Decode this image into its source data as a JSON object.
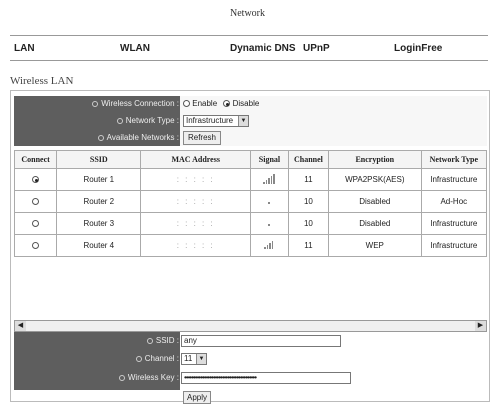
{
  "page": {
    "title": "Network"
  },
  "nav": [
    "LAN",
    "WLAN",
    "Dynamic DNS",
    "UPnP",
    "LoginFree"
  ],
  "section": {
    "title": "Wireless LAN"
  },
  "top_form": {
    "wireless_connection_label": "Wireless Connection :",
    "enable_label": "Enable",
    "disable_label": "Disable",
    "selected": "Disable",
    "network_type_label": "Network Type :",
    "network_type_value": "Infrastructure",
    "available_networks_label": "Available Networks :",
    "refresh_label": "Refresh"
  },
  "table": {
    "headers": [
      "Connect",
      "SSID",
      "MAC Address",
      "Signal",
      "Channel",
      "Encryption",
      "Network Type"
    ],
    "rows": [
      {
        "selected": true,
        "ssid": "Router 1",
        "mac": ": : : : :",
        "signal": 5,
        "channel": "11",
        "encryption": "WPA2PSK(AES)",
        "network_type": "Infrastructure"
      },
      {
        "selected": false,
        "ssid": "Router 2",
        "mac": ": : : : :",
        "signal": 0,
        "channel": "10",
        "encryption": "Disabled",
        "network_type": "Ad-Hoc"
      },
      {
        "selected": false,
        "ssid": "Router 3",
        "mac": ": : : : :",
        "signal": 1,
        "channel": "10",
        "encryption": "Disabled",
        "network_type": "Infrastructure"
      },
      {
        "selected": false,
        "ssid": "Router 4",
        "mac": ": : : : :",
        "signal": 4,
        "channel": "11",
        "encryption": "WEP",
        "network_type": "Infrastructure"
      }
    ]
  },
  "bottom_form": {
    "ssid_label": "SSID :",
    "ssid_value": "any",
    "channel_label": "Channel :",
    "channel_value": "11",
    "key_label": "Wireless Key :",
    "key_value": "••••••••••••••••••••••••••••••••••••••••",
    "apply_label": "Apply"
  }
}
